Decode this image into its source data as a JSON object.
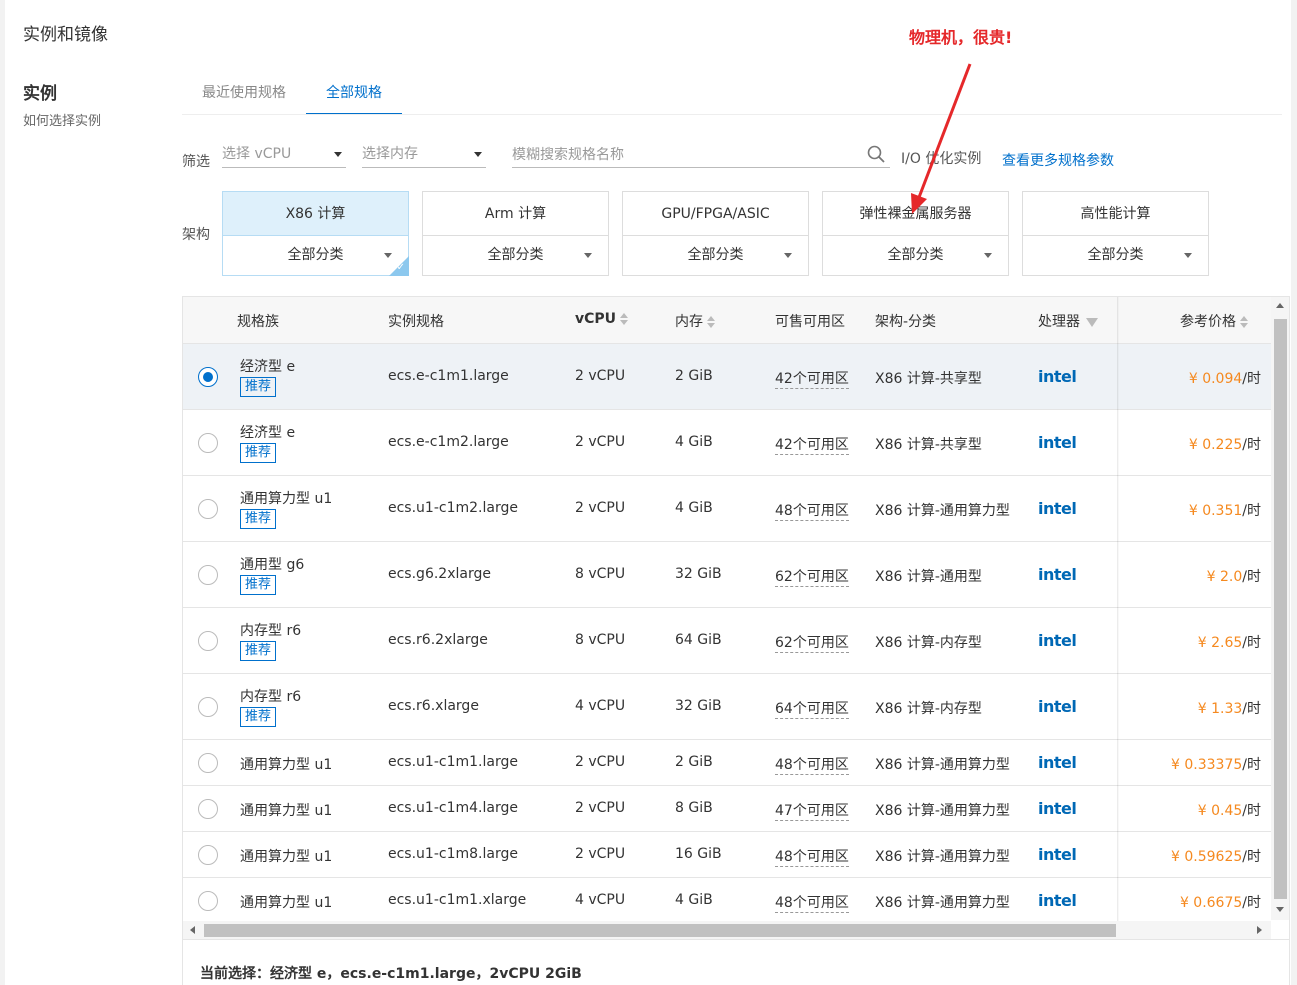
{
  "page": {
    "section_title": "实例和镜像",
    "instance_title": "实例",
    "instance_help": "如何选择实例"
  },
  "tabs": [
    {
      "label": "最近使用规格",
      "active": false
    },
    {
      "label": "全部规格",
      "active": true
    }
  ],
  "filter": {
    "label": "筛选",
    "vcpu_placeholder": "选择 vCPU",
    "memory_placeholder": "选择内存",
    "search_placeholder": "模糊搜索规格名称",
    "io_label": "I/O 优化实例",
    "more_link": "查看更多规格参数"
  },
  "arch": {
    "label": "架构",
    "cards": [
      {
        "title": "X86 计算",
        "category": "全部分类",
        "active": true
      },
      {
        "title": "Arm 计算",
        "category": "全部分类",
        "active": false
      },
      {
        "title": "GPU/FPGA/ASIC",
        "category": "全部分类",
        "active": false
      },
      {
        "title": "弹性裸金属服务器",
        "category": "全部分类",
        "active": false
      },
      {
        "title": "高性能计算",
        "category": "全部分类",
        "active": false
      }
    ]
  },
  "annotation": {
    "text": "物理机，很贵!",
    "color": "#e5282a"
  },
  "table": {
    "headers": {
      "family": "规格族",
      "spec": "实例规格",
      "vcpu": "vCPU",
      "memory": "内存",
      "zones": "可售可用区",
      "arch": "架构-分类",
      "processor": "处理器",
      "price": "参考价格"
    },
    "badge_label": "推荐",
    "processor_label": "intel",
    "price_unit": "/时",
    "rows": [
      {
        "family": "经济型 e",
        "recommended": true,
        "selected": true,
        "spec": "ecs.e-c1m1.large",
        "vcpu": "2 vCPU",
        "memory": "2 GiB",
        "zones": "42个可用区",
        "arch": "X86 计算-共享型",
        "price": "¥ 0.094"
      },
      {
        "family": "经济型 e",
        "recommended": true,
        "selected": false,
        "spec": "ecs.e-c1m2.large",
        "vcpu": "2 vCPU",
        "memory": "4 GiB",
        "zones": "42个可用区",
        "arch": "X86 计算-共享型",
        "price": "¥ 0.225"
      },
      {
        "family": "通用算力型 u1",
        "recommended": true,
        "selected": false,
        "spec": "ecs.u1-c1m2.large",
        "vcpu": "2 vCPU",
        "memory": "4 GiB",
        "zones": "48个可用区",
        "arch": "X86 计算-通用算力型",
        "price": "¥ 0.351"
      },
      {
        "family": "通用型 g6",
        "recommended": true,
        "selected": false,
        "spec": "ecs.g6.2xlarge",
        "vcpu": "8 vCPU",
        "memory": "32 GiB",
        "zones": "62个可用区",
        "arch": "X86 计算-通用型",
        "price": "¥ 2.0"
      },
      {
        "family": "内存型 r6",
        "recommended": true,
        "selected": false,
        "spec": "ecs.r6.2xlarge",
        "vcpu": "8 vCPU",
        "memory": "64 GiB",
        "zones": "62个可用区",
        "arch": "X86 计算-内存型",
        "price": "¥ 2.65"
      },
      {
        "family": "内存型 r6",
        "recommended": true,
        "selected": false,
        "spec": "ecs.r6.xlarge",
        "vcpu": "4 vCPU",
        "memory": "32 GiB",
        "zones": "64个可用区",
        "arch": "X86 计算-内存型",
        "price": "¥ 1.33"
      },
      {
        "family": "通用算力型 u1",
        "recommended": false,
        "selected": false,
        "spec": "ecs.u1-c1m1.large",
        "vcpu": "2 vCPU",
        "memory": "2 GiB",
        "zones": "48个可用区",
        "arch": "X86 计算-通用算力型",
        "price": "¥ 0.33375"
      },
      {
        "family": "通用算力型 u1",
        "recommended": false,
        "selected": false,
        "spec": "ecs.u1-c1m4.large",
        "vcpu": "2 vCPU",
        "memory": "8 GiB",
        "zones": "47个可用区",
        "arch": "X86 计算-通用算力型",
        "price": "¥ 0.45"
      },
      {
        "family": "通用算力型 u1",
        "recommended": false,
        "selected": false,
        "spec": "ecs.u1-c1m8.large",
        "vcpu": "2 vCPU",
        "memory": "16 GiB",
        "zones": "48个可用区",
        "arch": "X86 计算-通用算力型",
        "price": "¥ 0.59625"
      },
      {
        "family": "通用算力型 u1",
        "recommended": false,
        "selected": false,
        "spec": "ecs.u1-c1m1.xlarge",
        "vcpu": "4 vCPU",
        "memory": "4 GiB",
        "zones": "48个可用区",
        "arch": "X86 计算-通用算力型",
        "price": "¥ 0.6675"
      }
    ]
  },
  "current_selection": "当前选择：经济型 e，ecs.e-c1m1.large，2vCPU 2GiB"
}
